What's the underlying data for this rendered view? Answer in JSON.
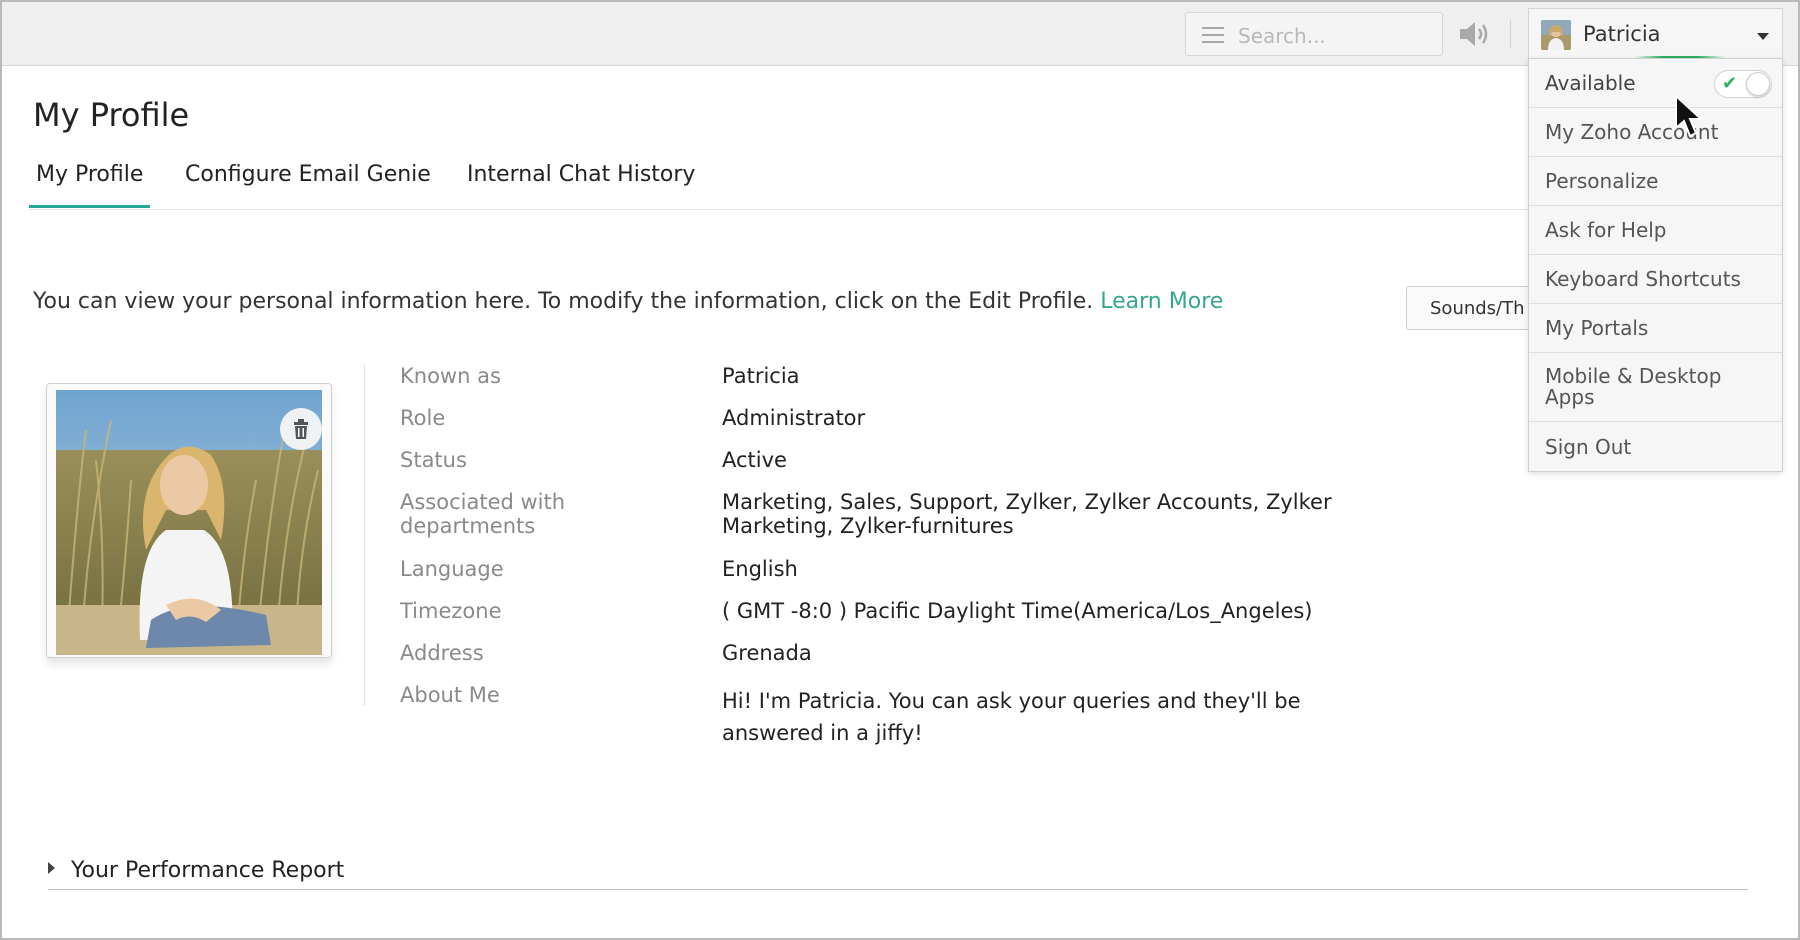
{
  "header": {
    "search_placeholder": "Search...",
    "user_name": "Patricia"
  },
  "user_menu": {
    "available_label": "Available",
    "available_on": true,
    "items": [
      "My Zoho Account",
      "Personalize",
      "Ask for Help",
      "Keyboard Shortcuts",
      "My Portals",
      "Mobile & Desktop Apps",
      "Sign Out"
    ]
  },
  "page": {
    "title": "My Profile",
    "tabs": [
      "My Profile",
      "Configure Email Genie",
      "Internal Chat History"
    ],
    "active_tab": 0,
    "intro_text": "You can view your personal information here. To modify the information, click on the Edit Profile.",
    "learn_more": "Learn More",
    "sounds_button": "Sounds/Th"
  },
  "profile": {
    "fields": [
      {
        "label": "Known as",
        "value": "Patricia"
      },
      {
        "label": "Role",
        "value": "Administrator"
      },
      {
        "label": "Status",
        "value": "Active"
      },
      {
        "label": "Associated with departments",
        "value": "Marketing, Sales, Support, Zylker, Zylker Accounts, Zylker Marketing, Zylker-furnitures"
      },
      {
        "label": "Language",
        "value": "English"
      },
      {
        "label": "Timezone",
        "value": "( GMT -8:0 ) Pacific Daylight Time(America/Los_Angeles)"
      },
      {
        "label": "Address",
        "value": "Grenada"
      },
      {
        "label": "About Me",
        "value": "Hi! I'm Patricia. You can ask your queries and they'll be answered in a jiffy!"
      }
    ]
  },
  "performance": {
    "label": "Your Performance Report"
  },
  "colors": {
    "accent": "#2aa79b",
    "link": "#33a78f",
    "available_green": "#2ab160"
  }
}
